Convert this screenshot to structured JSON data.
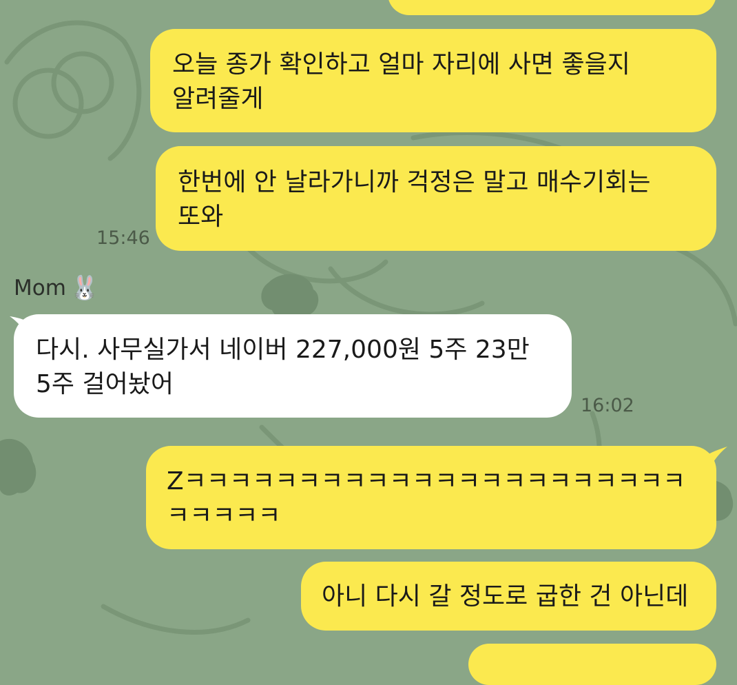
{
  "chat": {
    "messages": [
      {
        "from": "me",
        "text": "오늘 종가 확인하고 얼마 자리에 사면 좋을지 알려줄게"
      },
      {
        "from": "me",
        "text": "한번에 안 날라가니까 걱정은 말고 매수기회는 또와",
        "time": "15:46"
      },
      {
        "from": "mom",
        "sender": "Mom",
        "sender_emoji": "🐰",
        "text": "다시. 사무실가서 네이버 227,000원 5주  23만 5주 걸어놨어",
        "time": "16:02"
      },
      {
        "from": "me",
        "text": "Zㅋㅋㅋㅋㅋㅋㅋㅋㅋㅋㅋㅋㅋㅋㅋㅋㅋㅋㅋㅋㅋㅋㅋㅋㅋㅋㅋ"
      },
      {
        "from": "me",
        "text": "아니 다시 갈 정도로 굽한 건 아닌데"
      }
    ]
  },
  "colors": {
    "background": "#8aa687",
    "my_bubble": "#fbe94f",
    "their_bubble": "#ffffff"
  }
}
